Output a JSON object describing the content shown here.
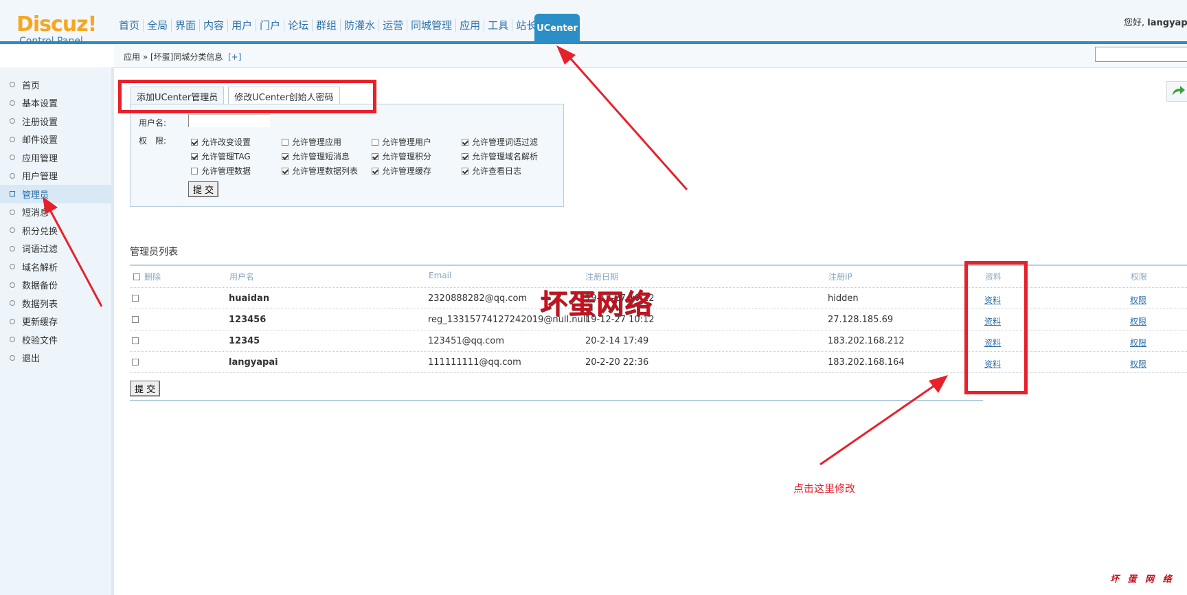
{
  "logo": {
    "main": "Discuz!",
    "sub": "Control Panel"
  },
  "nav": {
    "items": [
      "首页",
      "全局",
      "界面",
      "内容",
      "用户",
      "门户",
      "论坛",
      "群组",
      "防灌水",
      "运营",
      "同城管理",
      "应用",
      "工具",
      "站长"
    ],
    "active": "UCenter"
  },
  "header": {
    "greeting": "您好,",
    "username": "langyapa"
  },
  "breadcrumb": {
    "text": "应用 » [坏蛋]同城分类信息",
    "add": "[+]"
  },
  "sidebar": {
    "items": [
      "首页",
      "基本设置",
      "注册设置",
      "邮件设置",
      "应用管理",
      "用户管理",
      "管理员",
      "短消息",
      "积分兑换",
      "词语过滤",
      "域名解析",
      "数据备份",
      "数据列表",
      "更新缓存",
      "校验文件",
      "退出"
    ]
  },
  "tabs": [
    "添加UCenter管理员",
    "修改UCenter创始人密码"
  ],
  "form": {
    "username_label": "用户名:",
    "perm_label": "权　限:",
    "perms": [
      {
        "label": "允许改变设置",
        "checked": true
      },
      {
        "label": "允许管理应用",
        "checked": false
      },
      {
        "label": "允许管理用户",
        "checked": false
      },
      {
        "label": "允许管理词语过滤",
        "checked": true
      },
      {
        "label": "允许管理TAG",
        "checked": true
      },
      {
        "label": "允许管理短消息",
        "checked": true
      },
      {
        "label": "允许管理积分",
        "checked": true
      },
      {
        "label": "允许管理域名解析",
        "checked": true
      },
      {
        "label": "允许管理数据",
        "checked": false
      },
      {
        "label": "允许管理数据列表",
        "checked": true
      },
      {
        "label": "允许管理缓存",
        "checked": true
      },
      {
        "label": "允许查看日志",
        "checked": true
      }
    ],
    "submit": "提 交"
  },
  "list": {
    "title": "管理员列表",
    "headers": [
      "删除",
      "用户名",
      "Email",
      "注册日期",
      "注册IP",
      "资料",
      "权限"
    ],
    "rows": [
      {
        "username": "huaidan",
        "email": "2320888282@qq.com",
        "date": "19-12-27 10:12",
        "ip": "hidden",
        "profile": "资料",
        "perm": "权限"
      },
      {
        "username": "123456",
        "email": "reg_13315774127242019@null.null",
        "date": "19-12-27 10:12",
        "ip": "27.128.185.69",
        "profile": "资料",
        "perm": "权限"
      },
      {
        "username": "12345",
        "email": "123451@qq.com",
        "date": "20-2-14 17:49",
        "ip": "183.202.168.212",
        "profile": "资料",
        "perm": "权限"
      },
      {
        "username": "langyapai",
        "email": "111111111@qq.com",
        "date": "20-2-20 22:36",
        "ip": "183.202.168.164",
        "profile": "资料",
        "perm": "权限"
      }
    ],
    "submit": "提 交"
  },
  "annotations": {
    "watermark": "坏蛋网络",
    "note": "点击这里修改",
    "footer": "坏 蛋 网 络"
  }
}
